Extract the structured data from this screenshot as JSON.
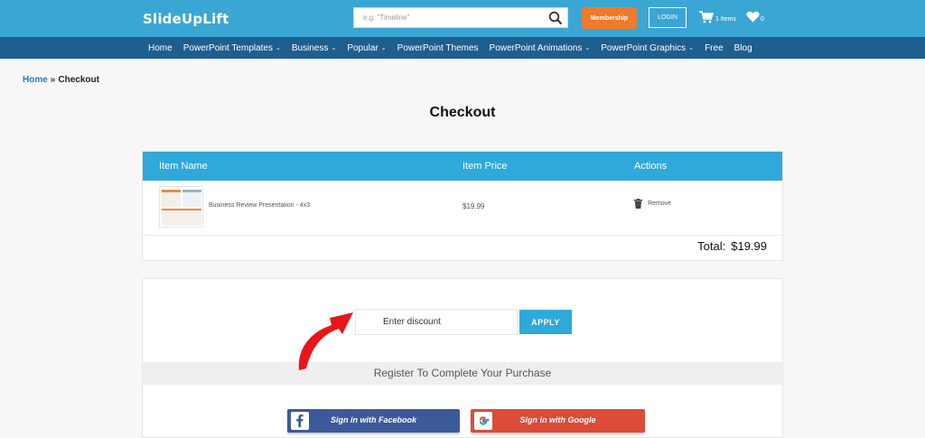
{
  "header": {
    "logo": "SlideUpLift",
    "search_placeholder": "e.g. \"Timeline\"",
    "membership_label": "Membership",
    "login_label": "LOGIN",
    "cart_count": "1 Items",
    "wishlist_count": "0",
    "brand_color": "#3aa6d4",
    "accent_color": "#f07a2b"
  },
  "nav": {
    "items": [
      {
        "label": "Home",
        "caret": ""
      },
      {
        "label": "PowerPoint Templates",
        "caret": "⌄"
      },
      {
        "label": "Business",
        "caret": "⌄"
      },
      {
        "label": "Popular",
        "caret": "⌄"
      },
      {
        "label": "PowerPoint Themes",
        "caret": ""
      },
      {
        "label": "PowerPoint Animations",
        "caret": "⌄"
      },
      {
        "label": "PowerPoint Graphics",
        "caret": "⌄"
      },
      {
        "label": "Free",
        "caret": ""
      },
      {
        "label": "Blog",
        "caret": ""
      }
    ]
  },
  "breadcrumb": {
    "home": "Home",
    "separator": "»",
    "current": "Checkout"
  },
  "page_title": "Checkout",
  "cart_table": {
    "headers": {
      "name": "Item Name",
      "price": "Item Price",
      "actions": "Actions"
    },
    "rows": [
      {
        "name": "Business Review Presentation - 4x3",
        "price": "$19.99",
        "action": "Remove"
      }
    ],
    "total_label": "Total:",
    "total_value": "$19.99"
  },
  "discount": {
    "placeholder": "Enter discount",
    "apply_label": "APPLY"
  },
  "register": {
    "heading": "Register To Complete Your Purchase",
    "facebook_label": "Sign in with Facebook",
    "google_label": "Sign in with Google"
  }
}
